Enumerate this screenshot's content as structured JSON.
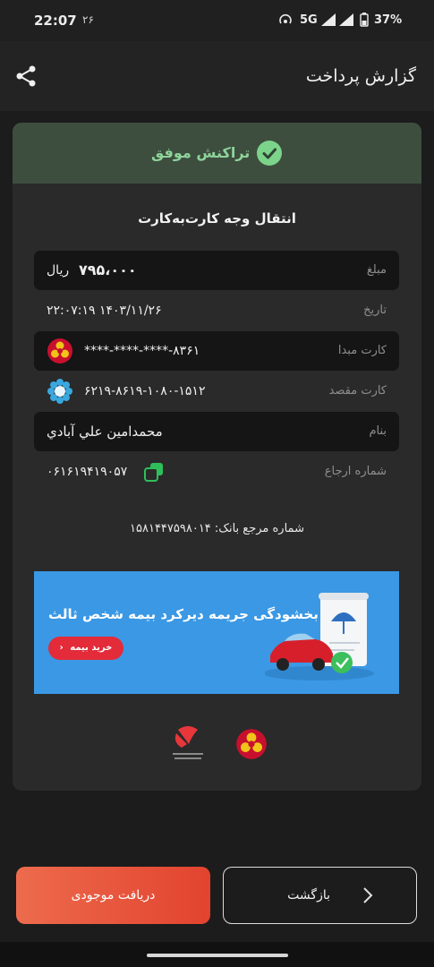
{
  "status_bar": {
    "time": "22:07",
    "date_small": "۲۶",
    "network": "5G",
    "battery": "37%"
  },
  "header": {
    "title": "گزارش پرداخت",
    "share_icon": "share-icon"
  },
  "result": {
    "status": "تراکنش موفق",
    "status_color": "#7cd38a",
    "type": "انتقال وجه کارت‌به‌کارت"
  },
  "details": {
    "amount": {
      "label": "مبلغ",
      "value": "۷۹۵،۰۰۰",
      "unit": "ریال"
    },
    "date": {
      "label": "تاریخ",
      "value": "۲۲:۰۷:۱۹ ۱۴۰۳/۱۱/۲۶"
    },
    "source_card": {
      "label": "کارت مبدا",
      "value": "****-****-****-۸۳۶۱",
      "bank_icon": "bank-mellat-logo"
    },
    "dest_card": {
      "label": "کارت مقصد",
      "value": "۶۲۱۹-۸۶۱۹-۱۰۸۰-۱۵۱۲",
      "bank_icon": "bank-saman-logo"
    },
    "name": {
      "label": "بنام",
      "value": "محمدامين علي آبادي"
    },
    "reference": {
      "label": "شماره ارجاع",
      "value": "۰۶۱۶۱۹۴۱۹۰۵۷",
      "copy_icon": "copy-icon"
    }
  },
  "bank_reference": "شماره مرجع بانک: ۱۵۸۱۴۴۷۵۹۸۰۱۴",
  "banner": {
    "text": "بخشودگی جریمه دیرکرد بیمه شخص ثالث",
    "button": "خرید بیمه",
    "accent": "#3b98e4"
  },
  "buttons": {
    "balance": "دریافت موجودی",
    "back": "بازگشت"
  }
}
